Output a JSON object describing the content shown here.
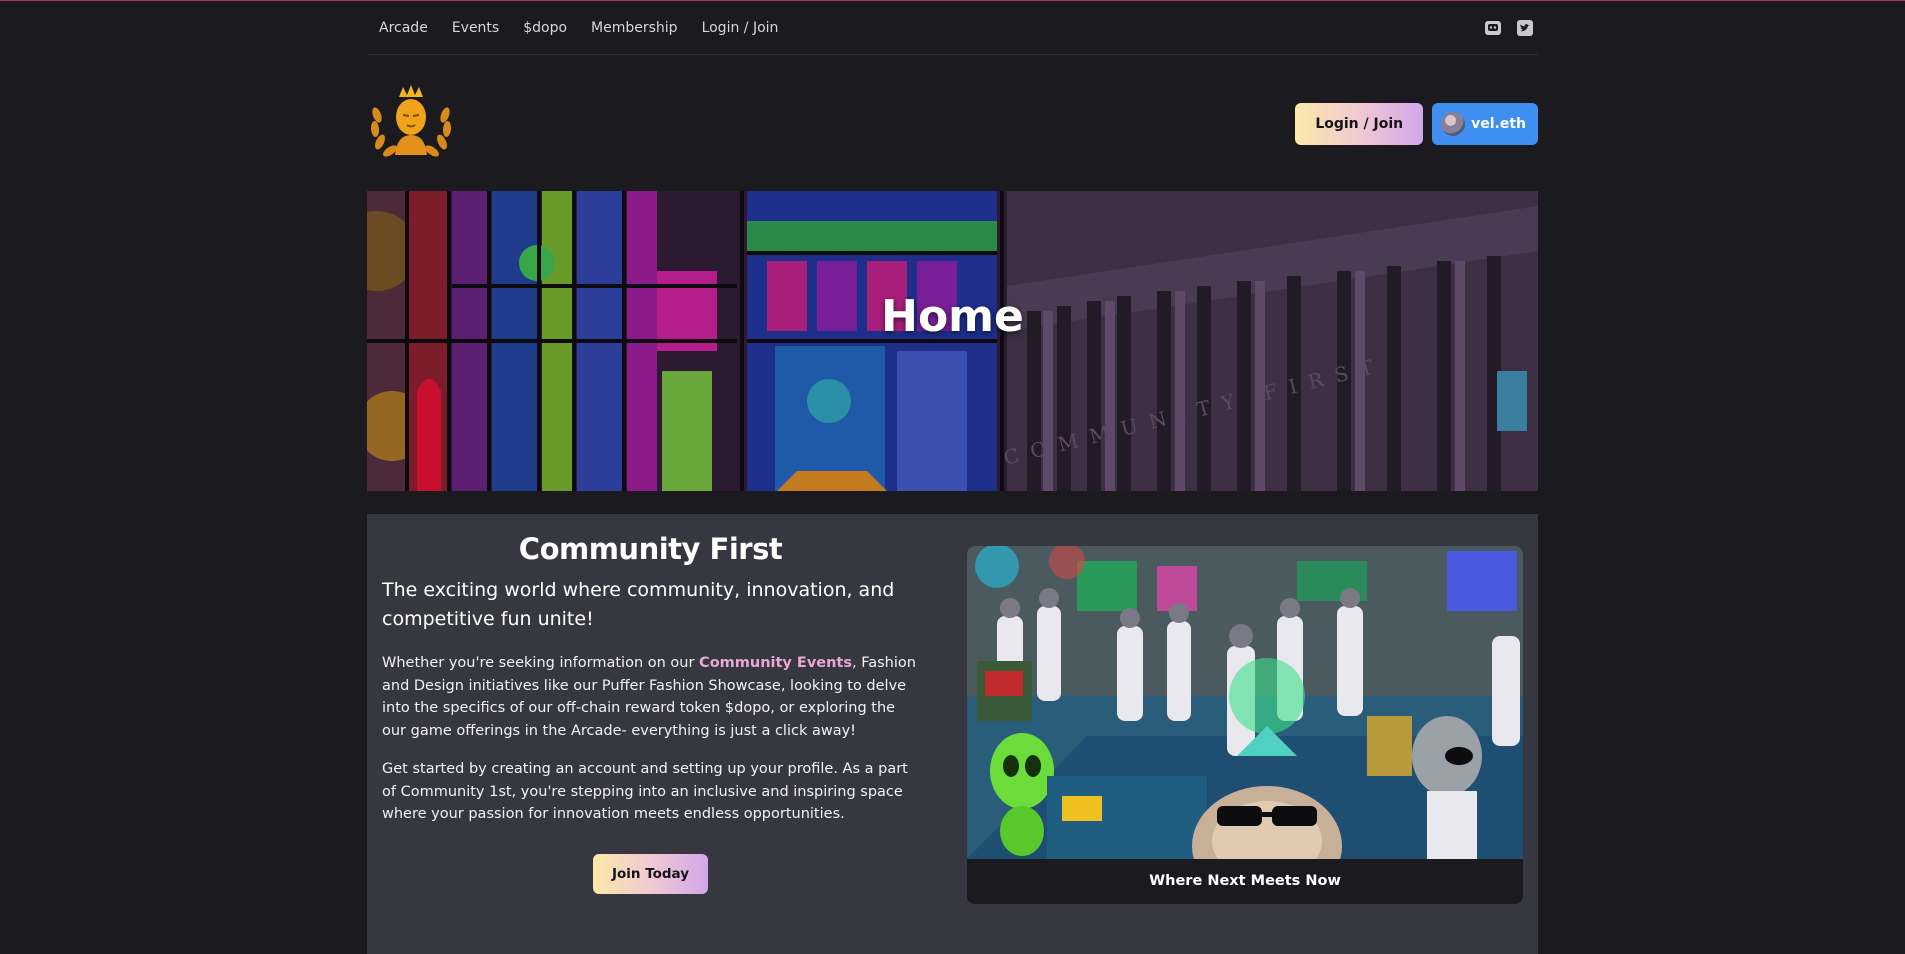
{
  "nav": {
    "links": [
      "Arcade",
      "Events",
      "$dopo",
      "Membership",
      "Login / Join"
    ],
    "social": [
      "discord-icon",
      "twitter-icon"
    ]
  },
  "header": {
    "login_label": "Login / Join",
    "wallet_label": "vel.eth"
  },
  "hero": {
    "title": "Home",
    "sign_text": "COMMUNITY FIRST"
  },
  "intro": {
    "title": "Community First",
    "lead": "The exciting world where community, innovation, and competitive fun unite!",
    "p1_before": "Whether you're seeking information on our ",
    "p1_link": "Community Events",
    "p1_after": ", Fashion and Design initiatives like our Puffer Fashion Showcase, looking to delve into the specifics of our off-chain reward token $dopo, or exploring the our game offerings in the Arcade- everything is just a click away!",
    "p2": "Get started by creating an account and setting up your profile. As a part of Community 1st, you're stepping into an inclusive and inspiring space where your passion for innovation meets endless opportunities.",
    "join_label": "Join Today"
  },
  "feature": {
    "caption": "Where Next Meets Now"
  },
  "colors": {
    "background": "#1a1a1f",
    "card": "#363740",
    "wallet_button": "#3f8ff2",
    "link_accent": "#e8a9d6"
  }
}
